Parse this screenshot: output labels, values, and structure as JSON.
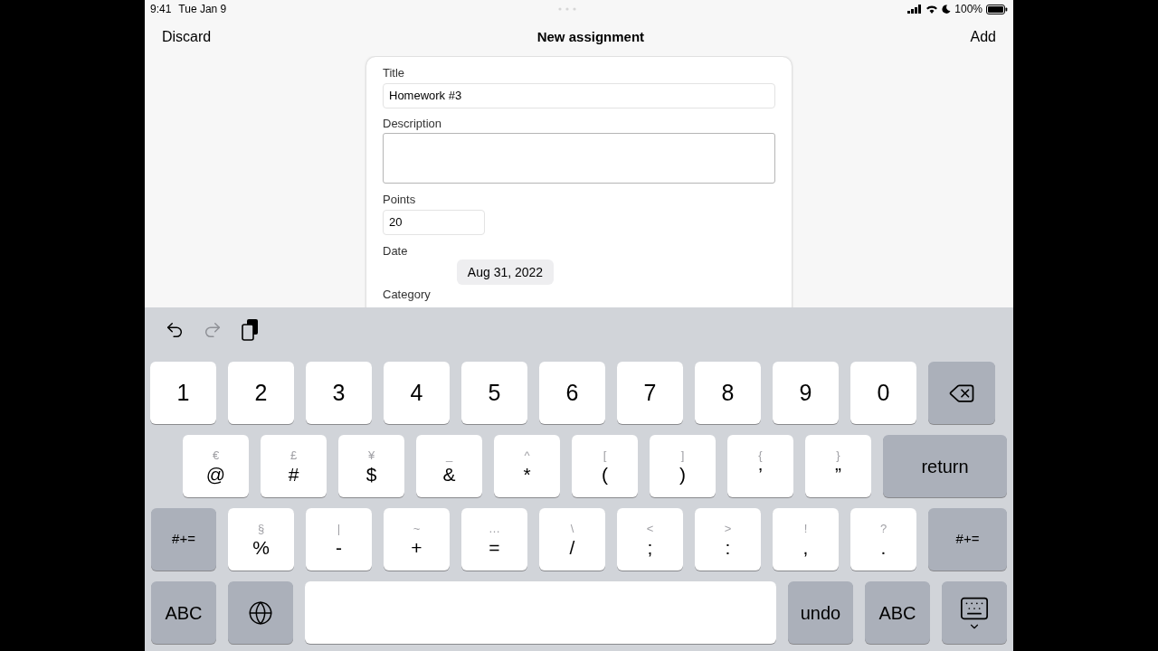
{
  "status_bar": {
    "time": "9:41",
    "date": "Tue Jan 9",
    "battery": "100%"
  },
  "nav": {
    "left": "Discard",
    "title": "New assignment",
    "right": "Add"
  },
  "form": {
    "title_label": "Title",
    "title_value": "Homework #3",
    "description_label": "Description",
    "points_label": "Points",
    "points_value": "20",
    "date_label": "Date",
    "date_value": "Aug 31, 2022",
    "category_label": "Category"
  },
  "toolbar": [
    {
      "kind": "undo",
      "disabled": false
    },
    {
      "kind": "redo",
      "disabled": true
    },
    {
      "kind": "paste",
      "disabled": false
    }
  ],
  "keyboard": [
    [
      {
        "kind": "char",
        "label": "1"
      },
      {
        "kind": "char",
        "label": "2"
      },
      {
        "kind": "char",
        "label": "3"
      },
      {
        "kind": "char",
        "label": "4"
      },
      {
        "kind": "char",
        "label": "5"
      },
      {
        "kind": "char",
        "label": "6"
      },
      {
        "kind": "char",
        "label": "7"
      },
      {
        "kind": "char",
        "label": "8"
      },
      {
        "kind": "char",
        "label": "9"
      },
      {
        "kind": "char",
        "label": "0"
      },
      {
        "kind": "delete"
      }
    ],
    [
      {
        "kind": "char",
        "alt": "€",
        "label": "@"
      },
      {
        "kind": "char",
        "alt": "£",
        "label": "#"
      },
      {
        "kind": "char",
        "alt": "¥",
        "label": "$"
      },
      {
        "kind": "char",
        "alt": "_",
        "label": "&"
      },
      {
        "kind": "char",
        "alt": "^",
        "label": "*"
      },
      {
        "kind": "char",
        "alt": "[",
        "label": "("
      },
      {
        "kind": "char",
        "alt": "]",
        "label": ")"
      },
      {
        "kind": "char",
        "alt": "{",
        "label": "’"
      },
      {
        "kind": "char",
        "alt": "}",
        "label": "”"
      },
      {
        "kind": "return",
        "label": "return"
      }
    ],
    [
      {
        "kind": "function",
        "label": "#+="
      },
      {
        "kind": "char",
        "alt": "§",
        "label": "%"
      },
      {
        "kind": "char",
        "alt": "|",
        "label": "-"
      },
      {
        "kind": "char",
        "alt": "~",
        "label": "+"
      },
      {
        "kind": "char",
        "alt": "…",
        "label": "="
      },
      {
        "kind": "char",
        "alt": "\\",
        "label": "/"
      },
      {
        "kind": "char",
        "alt": "<",
        "label": ";"
      },
      {
        "kind": "char",
        "alt": ">",
        "label": ":"
      },
      {
        "kind": "char",
        "alt": "!",
        "label": ","
      },
      {
        "kind": "char",
        "alt": "?",
        "label": "."
      },
      {
        "kind": "function",
        "label": "#+="
      }
    ],
    [
      {
        "kind": "function",
        "label": "ABC"
      },
      {
        "kind": "globe"
      },
      {
        "kind": "space"
      },
      {
        "kind": "function",
        "label": "undo"
      },
      {
        "kind": "function",
        "label": "ABC"
      },
      {
        "kind": "dismiss"
      }
    ]
  ]
}
